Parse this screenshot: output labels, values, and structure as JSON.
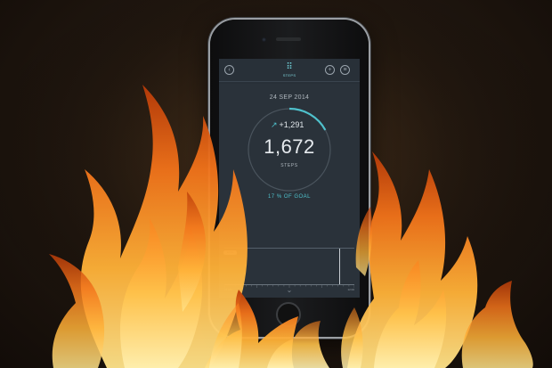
{
  "app": {
    "tab_label": "STEPS",
    "date": "24 SEP 2014",
    "delta": "+1,291",
    "steps": "1,672",
    "steps_label": "STEPS",
    "goal_percent": "17",
    "goal_suffix": "% OF GOAL",
    "goal_progress": 0.17,
    "timeline_badge": "12:01",
    "timeline_left": "12 AM",
    "timeline_right": "12:00"
  },
  "icons": {
    "back": "back-icon",
    "steps": "footprints-icon",
    "add": "add-icon",
    "menu": "menu-icon",
    "trend": "arrow-up-right-icon",
    "more": "chevron-down-icon"
  },
  "colors": {
    "accent": "#4fc1cc",
    "screen_bg": "#2a323a",
    "flame_core": "#ffd66b",
    "flame_mid": "#ff8a1e",
    "flame_edge": "#b83a08"
  }
}
